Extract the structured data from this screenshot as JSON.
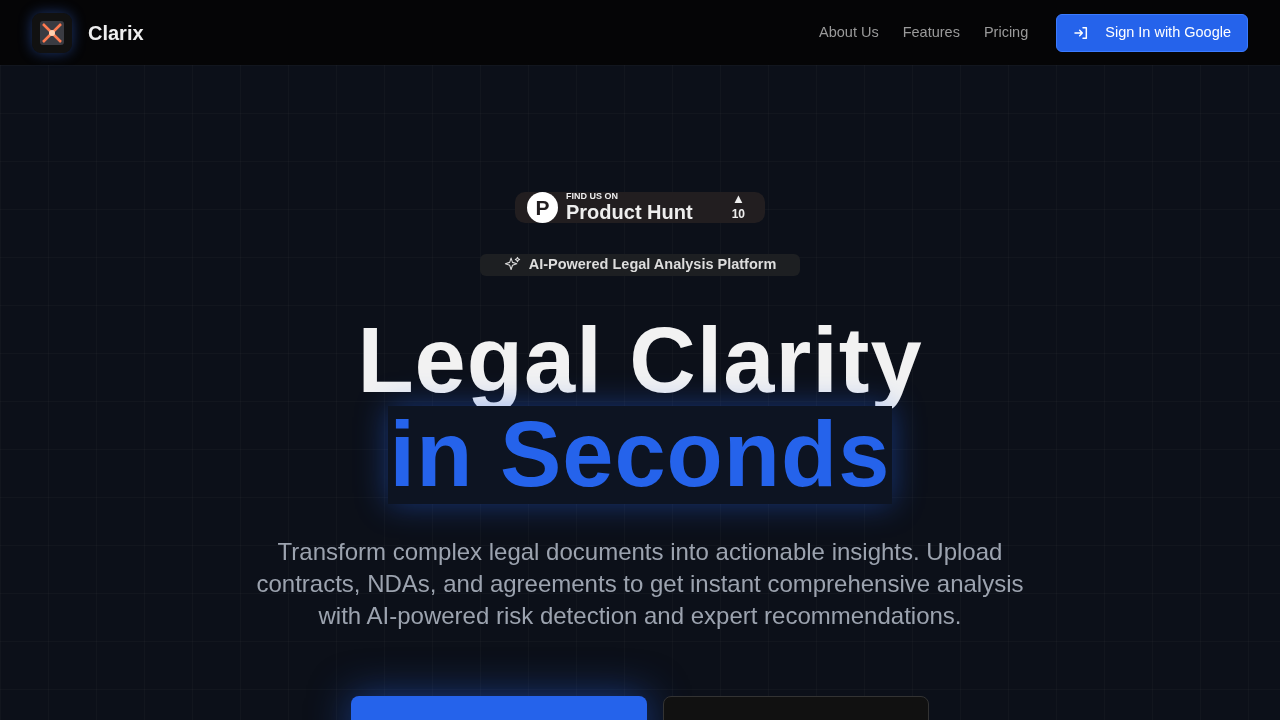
{
  "brand": {
    "name": "Clarix"
  },
  "nav": {
    "links": [
      "About Us",
      "Features",
      "Pricing"
    ],
    "signin": "Sign In with Google"
  },
  "product_hunt": {
    "eyebrow": "FIND US ON",
    "name": "Product Hunt",
    "logo_letter": "P",
    "arrow": "▲",
    "count": "10"
  },
  "pill": {
    "label": "AI-Powered Legal Analysis Platform"
  },
  "headline": {
    "line_1": "Legal Clarity",
    "line_2": "in Seconds"
  },
  "description": "Transform complex legal documents into actionable insights. Upload contracts, NDAs, and agreements to get instant comprehensive analysis with AI-powered risk detection and expert recommendations.",
  "cta_buttons": [
    {
      "kind": "primary"
    },
    {
      "kind": "secondary"
    }
  ]
}
